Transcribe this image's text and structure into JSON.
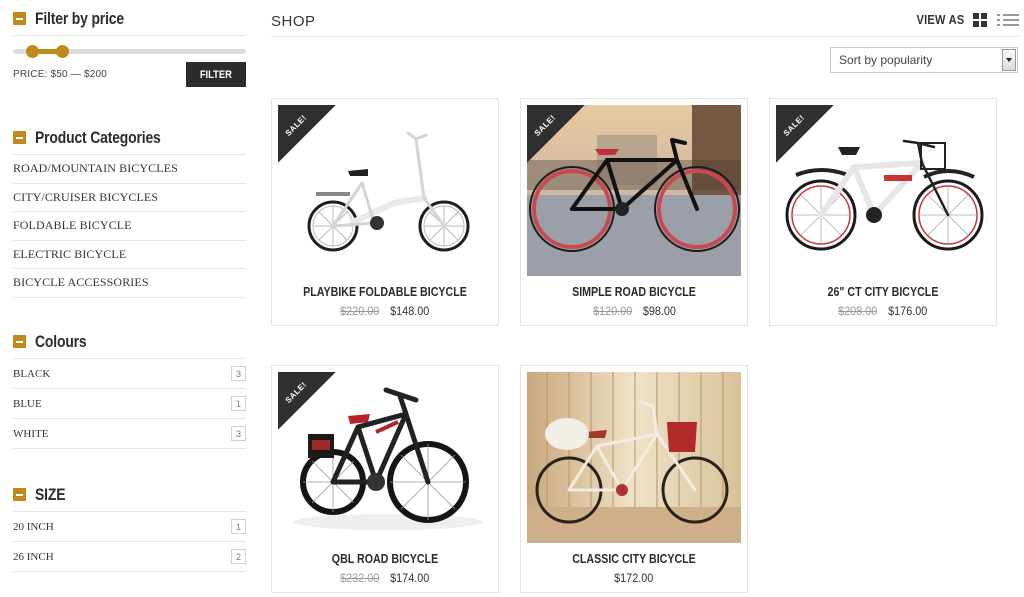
{
  "sidebar": {
    "price_filter": {
      "title": "Filter by price",
      "label": "PRICE: $50 — $200",
      "range_min_fraction": 0.08,
      "range_max_fraction": 0.21,
      "button": "FILTER"
    },
    "categories": {
      "title": "Product Categories",
      "items": [
        "ROAD/MOUNTAIN BICYCLES",
        "CITY/CRUISER BICYCLES",
        "FOLDABLE BICYCLE",
        "ELECTRIC BICYCLE",
        "BICYCLE ACCESSORIES"
      ]
    },
    "colours": {
      "title": "Colours",
      "items": [
        {
          "label": "BLACK",
          "count": "3"
        },
        {
          "label": "BLUE",
          "count": "1"
        },
        {
          "label": "WHITE",
          "count": "3"
        }
      ]
    },
    "size": {
      "title": "SIZE",
      "items": [
        {
          "label": "20 INCH",
          "count": "1"
        },
        {
          "label": "26 INCH",
          "count": "2"
        }
      ]
    }
  },
  "main": {
    "title": "SHOP",
    "view_as": "VIEW AS",
    "sort": "Sort by popularity",
    "sale_badge": "SALE!",
    "products": [
      {
        "name": "PLAYBIKE FOLDABLE BICYCLE",
        "old_price": "$220.00",
        "price": "$148.00",
        "sale": true
      },
      {
        "name": "SIMPLE ROAD BICYCLE",
        "old_price": "$120.00",
        "price": "$98.00",
        "sale": true
      },
      {
        "name": "26\" CT CITY BICYCLE",
        "old_price": "$208.00",
        "price": "$176.00",
        "sale": true
      },
      {
        "name": "QBL ROAD BICYCLE",
        "old_price": "$232.00",
        "price": "$174.00",
        "sale": true
      },
      {
        "name": "CLASSIC CITY BICYCLE",
        "old_price": "",
        "price": "$172.00",
        "sale": false
      }
    ]
  },
  "colors": {
    "accent": "#c08a1a",
    "dark": "#2b2b2b"
  }
}
